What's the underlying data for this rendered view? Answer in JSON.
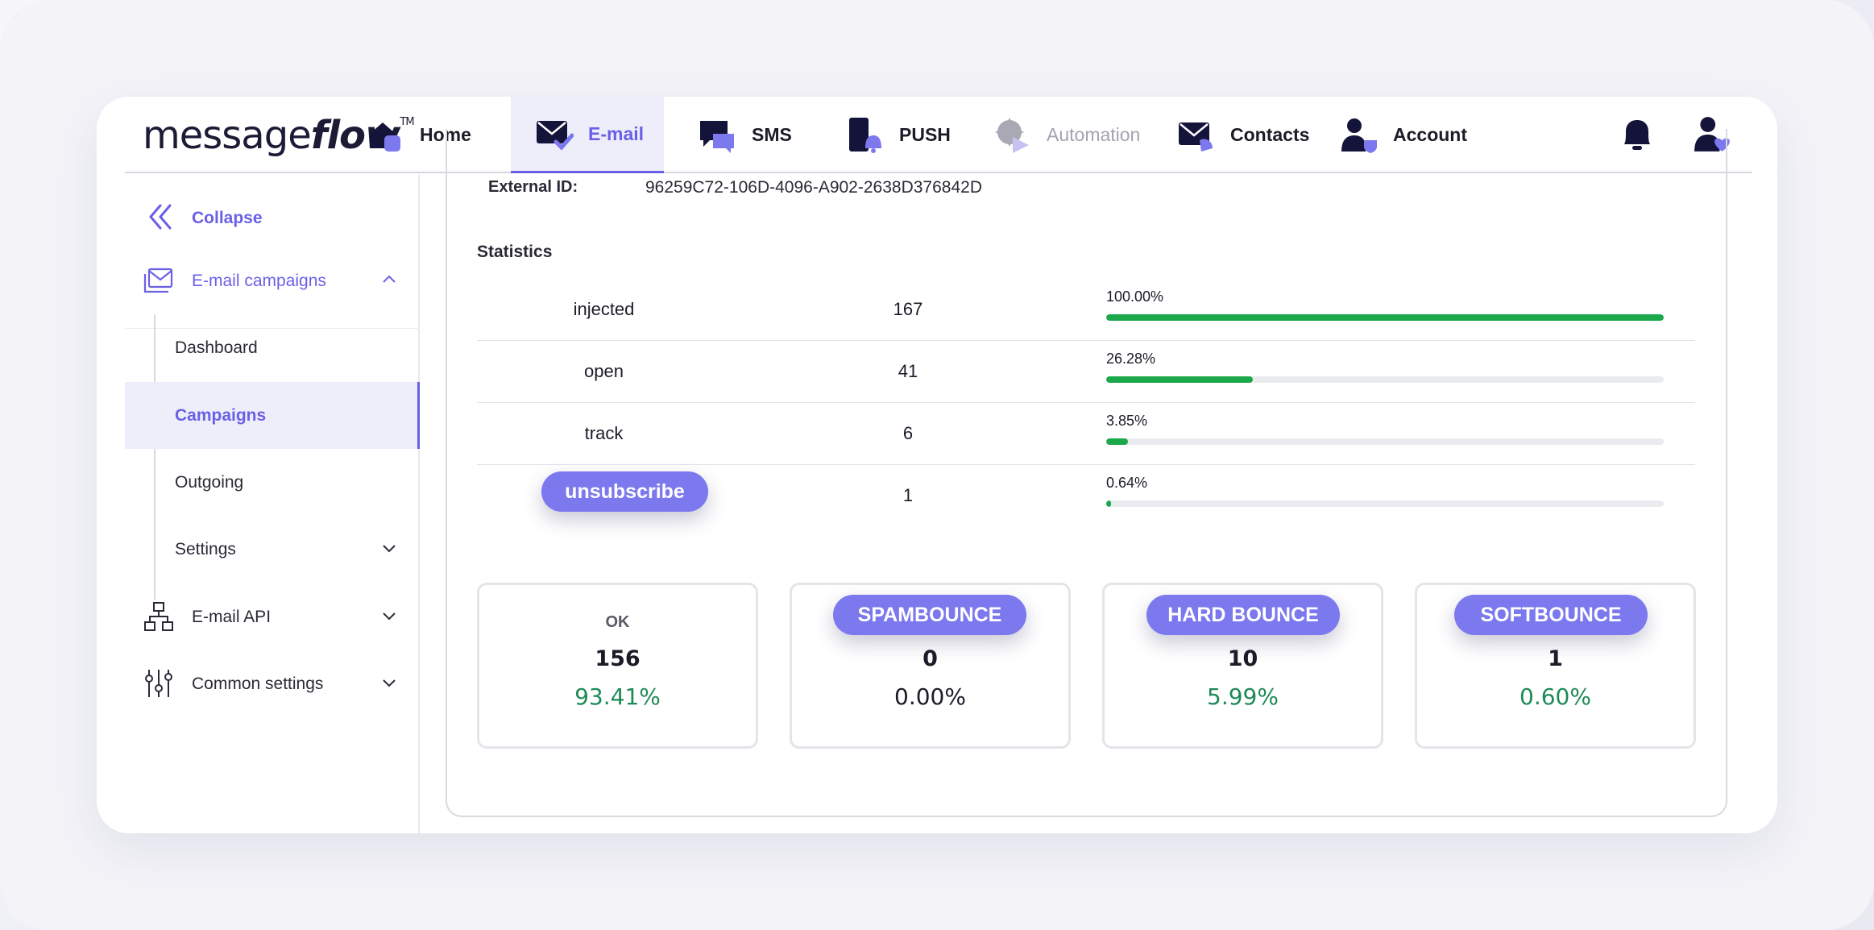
{
  "logo": {
    "light": "message",
    "bold": "flow",
    "tm": "TM"
  },
  "nav": [
    {
      "label": "Home",
      "icon": "home-icon"
    },
    {
      "label": "E-mail",
      "icon": "email-icon"
    },
    {
      "label": "SMS",
      "icon": "sms-icon"
    },
    {
      "label": "PUSH",
      "icon": "push-icon"
    },
    {
      "label": "Automation",
      "icon": "automation-icon"
    },
    {
      "label": "Contacts",
      "icon": "contacts-icon"
    },
    {
      "label": "Account",
      "icon": "account-icon"
    }
  ],
  "sidebar": {
    "collapse": "Collapse",
    "email_campaigns": "E-mail campaigns",
    "sub": [
      "Dashboard",
      "Campaigns",
      "Outgoing",
      "Settings"
    ],
    "email_api": "E-mail API",
    "common_settings": "Common settings"
  },
  "details": {
    "external_id_label": "External ID:",
    "external_id_value": "96259C72-106D-4096-A902-2638D376842D"
  },
  "statistics": {
    "title": "Statistics",
    "rows": [
      {
        "name": "injected",
        "count": "167",
        "pct": "100.00%",
        "fraction": 1.0
      },
      {
        "name": "open",
        "count": "41",
        "pct": "26.28%",
        "fraction": 0.2628
      },
      {
        "name": "track",
        "count": "6",
        "pct": "3.85%",
        "fraction": 0.0385
      },
      {
        "name": "unsubscribe",
        "count": "1",
        "pct": "0.64%",
        "fraction": 0.0064
      }
    ]
  },
  "tiles": [
    {
      "label": "OK",
      "count": "156",
      "pct": "93.41%"
    },
    {
      "label": "SPAMBOUNCE",
      "count": "0",
      "pct": "0.00%"
    },
    {
      "label": "HARD BOUNCE",
      "count": "10",
      "pct": "5.99%"
    },
    {
      "label": "SOFTBOUNCE",
      "count": "1",
      "pct": "0.60%"
    }
  ],
  "colors": {
    "accent": "#6a60e6",
    "pill": "#7c78ee",
    "progress": "#1aa84a",
    "positive": "#1f8a57"
  }
}
